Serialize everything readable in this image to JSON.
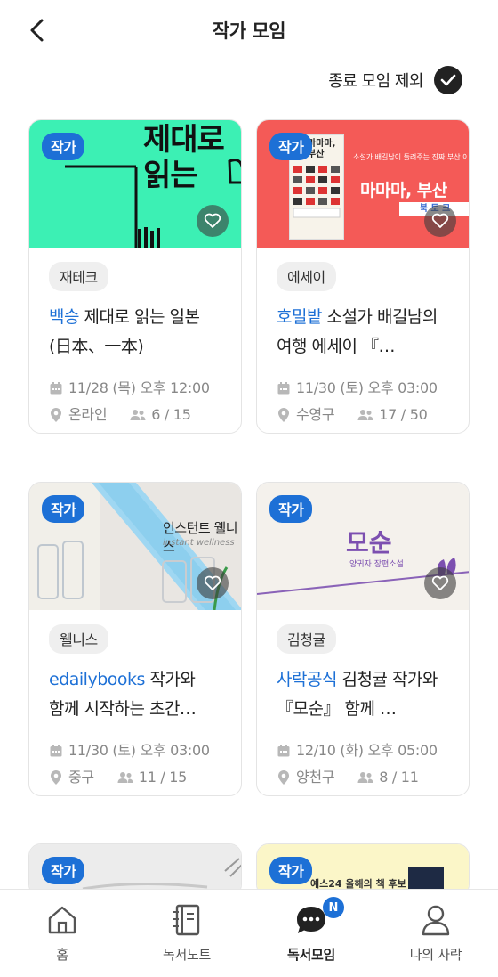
{
  "header": {
    "title": "작가 모임"
  },
  "filter": {
    "label": "종료 모임 제외",
    "checked": true
  },
  "cards": [
    {
      "badge": "작가",
      "tag": "재테크",
      "author": "백승",
      "title": " 제대로 읽는 일본(日本、一本)",
      "date": "11/28 (목) 오후 12:00",
      "location": "온라인",
      "members": "6 / 15",
      "cover_text": "제대로 읽는",
      "cover_color": "#3cf0b4"
    },
    {
      "badge": "작가",
      "tag": "에세이",
      "author": "호밀밭",
      "title": " 소설가 배길남의 여행 에세이 『…",
      "date": "11/30 (토) 오후 03:00",
      "location": "수영구",
      "members": "17 / 50",
      "cover_text": "마마마, 부산",
      "cover_sub": "소설가 배길남이 들려주는 진짜 부산 이야기",
      "cover_mini": "마마마, 부산",
      "cover_strip": "북 토 크",
      "cover_color": "#f45a57"
    },
    {
      "badge": "작가",
      "tag": "웰니스",
      "author": "edailybooks",
      "title": " 작가와 함께 시작하는 초간…",
      "date": "11/30 (토) 오후 03:00",
      "location": "중구",
      "members": "11 / 15",
      "cover_text": "인스턴트 웰니스",
      "cover_sub": "instant wellness",
      "cover_color": "#e9e6e2"
    },
    {
      "badge": "작가",
      "tag": "김청귤",
      "author": "사락공식",
      "title": " 김청귤 작가와 『모순』 함께 …",
      "date": "12/10 (화) 오후 05:00",
      "location": "양천구",
      "members": "8 / 11",
      "cover_text": "모순",
      "cover_sub": "양귀자 장편소설",
      "cover_color": "#f4f1ec"
    },
    {
      "badge": "작가",
      "cover_color": "#ececec"
    },
    {
      "badge": "작가",
      "cover_text": "예스24 올해의 책 후보",
      "cover_color": "#fbf6c8"
    }
  ],
  "tabs": [
    {
      "label": "홈",
      "icon": "home-icon"
    },
    {
      "label": "독서노트",
      "icon": "notebook-icon"
    },
    {
      "label": "독서모임",
      "icon": "chat-icon",
      "badge": "N",
      "active": true
    },
    {
      "label": "나의 사락",
      "icon": "person-icon"
    }
  ],
  "colors": {
    "accent": "#1d70d6",
    "text": "#222222",
    "muted": "#888888"
  }
}
